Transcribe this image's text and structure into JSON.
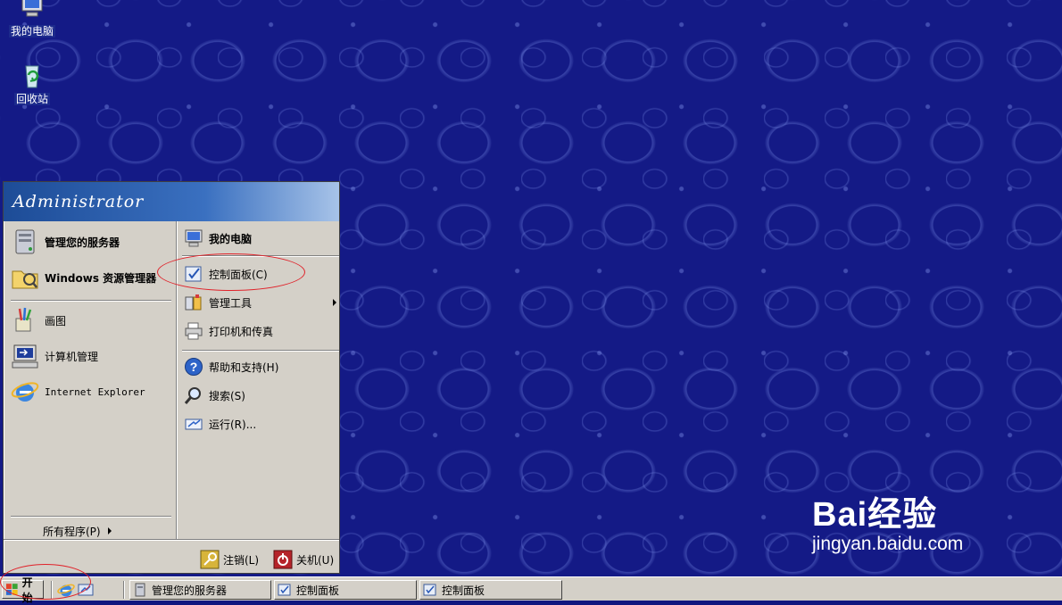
{
  "desktop": {
    "icons": [
      {
        "label": "我的电脑",
        "icon": "my-computer-icon"
      },
      {
        "label": "回收站",
        "icon": "recycle-bin-icon"
      }
    ]
  },
  "start_menu": {
    "user": "Administrator",
    "left_items": [
      {
        "label": "管理您的服务器",
        "icon": "server-manage-icon",
        "bold": true
      },
      {
        "label": "Windows 资源管理器",
        "icon": "folder-explorer-icon",
        "bold": true
      },
      {
        "label": "画图",
        "icon": "paint-icon"
      },
      {
        "label": "计算机管理",
        "icon": "computer-management-icon"
      },
      {
        "label": "Internet Explorer",
        "icon": "internet-explorer-icon"
      }
    ],
    "all_programs": "所有程序(P)",
    "right_items": [
      {
        "label": "我的电脑",
        "icon": "my-computer-icon",
        "bold": true
      },
      {
        "label": "控制面板(C)",
        "icon": "control-panel-icon"
      },
      {
        "label": "管理工具",
        "icon": "admin-tools-icon"
      },
      {
        "label": "打印机和传真",
        "icon": "printer-icon"
      },
      {
        "label": "帮助和支持(H)",
        "icon": "help-icon"
      },
      {
        "label": "搜索(S)",
        "icon": "search-icon"
      },
      {
        "label": "运行(R)...",
        "icon": "run-icon"
      }
    ],
    "logoff": "注销(L)",
    "shutdown": "关机(U)"
  },
  "taskbar": {
    "start_label": "开始",
    "tasks": [
      "管理您的服务器",
      "控制面板",
      "控制面板"
    ]
  },
  "watermark": {
    "logo": "Bai经验",
    "url": "jingyan.baidu.com"
  }
}
